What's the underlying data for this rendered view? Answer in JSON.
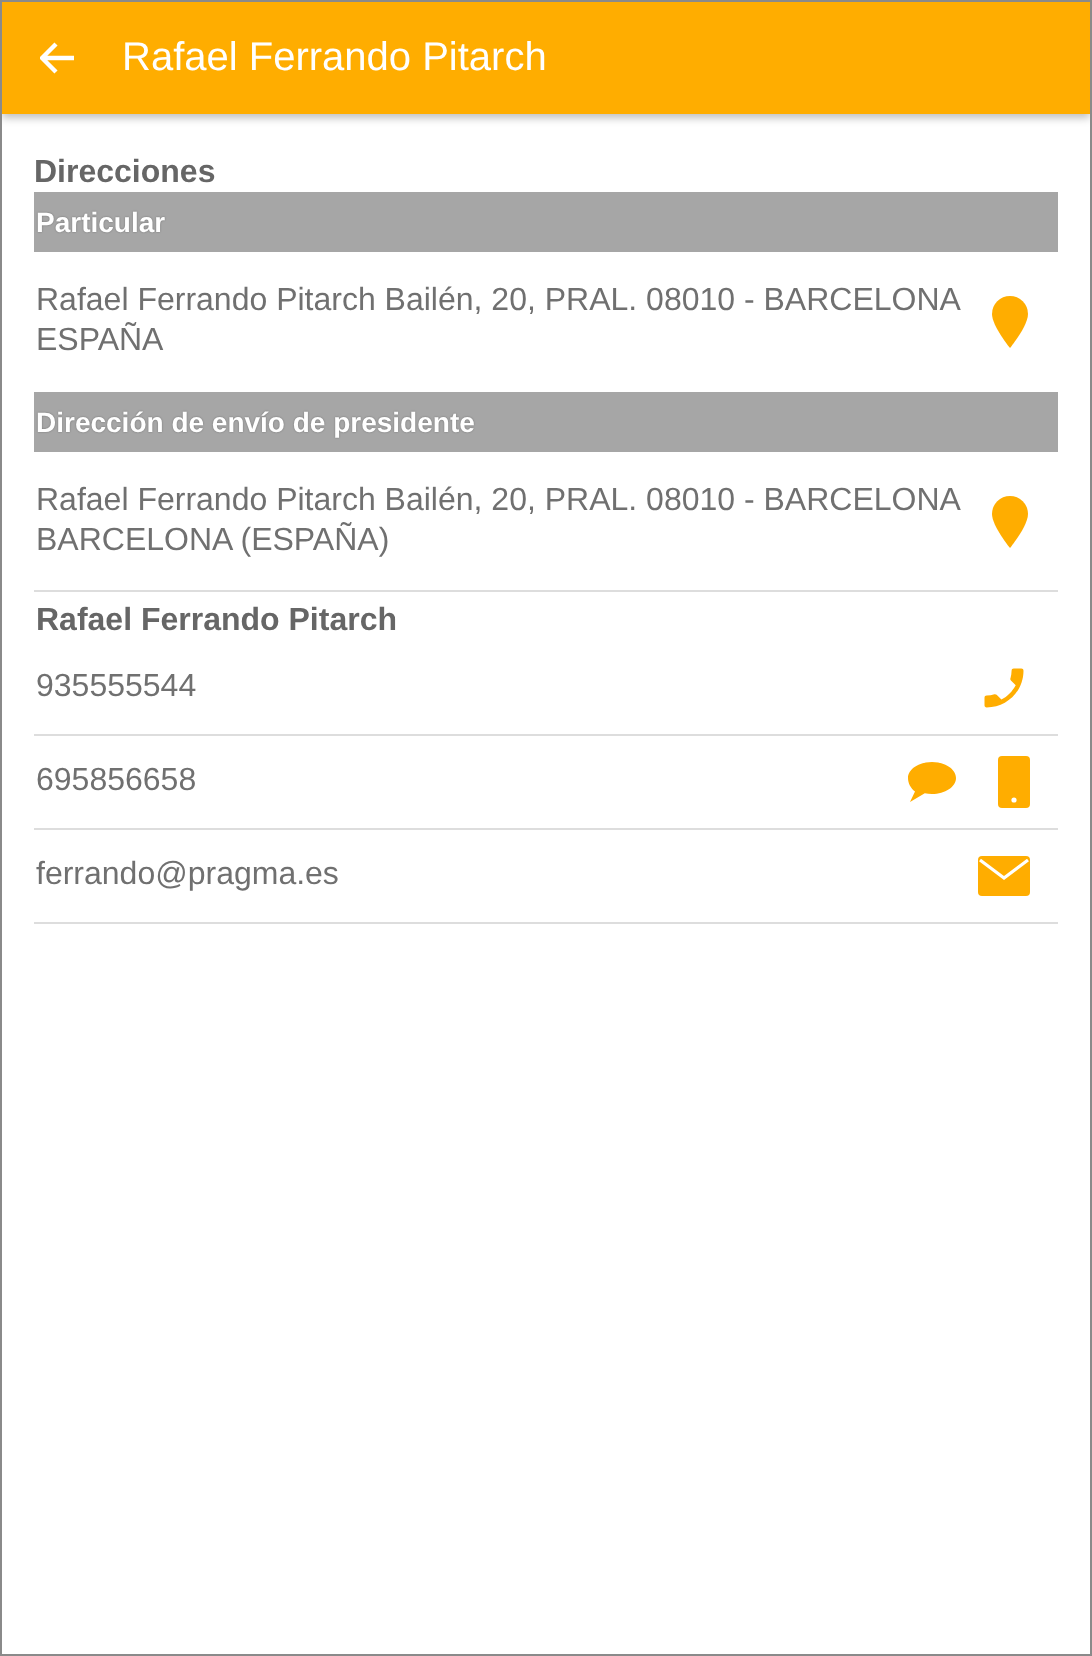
{
  "header": {
    "title": "Rafael Ferrando Pitarch"
  },
  "addresses_title": "Direcciones",
  "addresses": [
    {
      "heading": "Particular",
      "text": "Rafael Ferrando Pitarch Bailén, 20, PRAL. 08010 - BARCELONA ESPAÑA"
    },
    {
      "heading": "Dirección de envío de presidente",
      "text": "Rafael Ferrando Pitarch Bailén, 20, PRAL. 08010 - BARCELONA BARCELONA (ESPAÑA)"
    }
  ],
  "contact_name": "Rafael Ferrando Pitarch",
  "contacts": [
    {
      "kind": "phone",
      "value": "935555544"
    },
    {
      "kind": "mobile",
      "value": "695856658"
    },
    {
      "kind": "email",
      "value": "ferrando@pragma.es"
    }
  ]
}
